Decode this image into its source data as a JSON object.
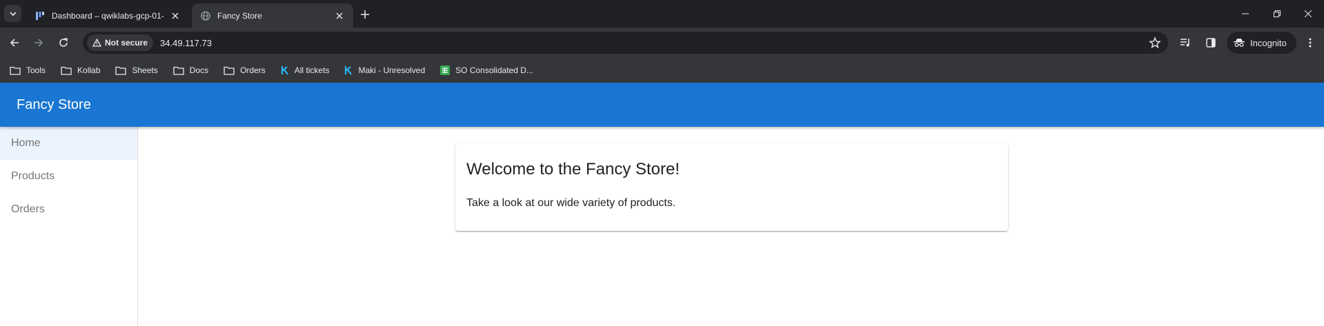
{
  "browser": {
    "tabs": [
      {
        "title": "Dashboard – qwiklabs-gcp-01-",
        "active": false,
        "icon": "dashboard-favicon"
      },
      {
        "title": "Fancy Store",
        "active": true,
        "icon": "globe-icon"
      }
    ],
    "omnibox": {
      "security_label": "Not secure",
      "url": "34.49.117.73"
    },
    "profile_label": "Incognito",
    "bookmarks": [
      {
        "label": "Tools",
        "icon": "folder-icon"
      },
      {
        "label": "Kollab",
        "icon": "folder-icon"
      },
      {
        "label": "Sheets",
        "icon": "folder-icon"
      },
      {
        "label": "Docs",
        "icon": "folder-icon"
      },
      {
        "label": "Orders",
        "icon": "folder-icon"
      },
      {
        "label": "All tickets",
        "icon": "k-icon"
      },
      {
        "label": "Maki - Unresolved",
        "icon": "k-icon"
      },
      {
        "label": "SO Consolidated D...",
        "icon": "sheets-icon"
      }
    ]
  },
  "app": {
    "title": "Fancy Store",
    "accent_color": "#1976d2",
    "nav": [
      {
        "label": "Home",
        "selected": true
      },
      {
        "label": "Products",
        "selected": false
      },
      {
        "label": "Orders",
        "selected": false
      }
    ],
    "card": {
      "heading": "Welcome to the Fancy Store!",
      "body": "Take a look at our wide variety of products."
    }
  }
}
